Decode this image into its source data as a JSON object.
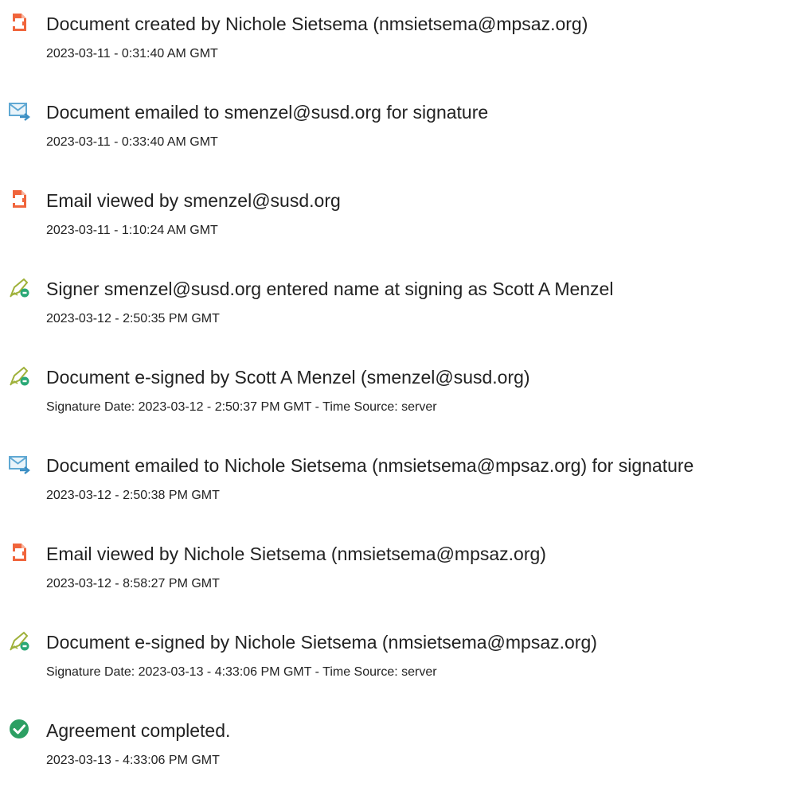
{
  "colors": {
    "document_icon": "#f0653c",
    "email_icon": "#5fa8d3",
    "sign_icon": "#9fb13a",
    "sign_badge": "#2aa876",
    "complete_icon": "#2c9f63",
    "text": "#222222"
  },
  "events": [
    {
      "icon": "document-icon",
      "title": "Document created by Nichole Sietsema (nmsietsema@mpsaz.org)",
      "detail": "2023-03-11 - 0:31:40 AM GMT"
    },
    {
      "icon": "email-icon",
      "title": "Document emailed to smenzel@susd.org for signature",
      "detail": "2023-03-11 - 0:33:40 AM GMT"
    },
    {
      "icon": "document-icon",
      "title": "Email viewed by smenzel@susd.org",
      "detail": "2023-03-11 - 1:10:24 AM GMT"
    },
    {
      "icon": "sign-icon",
      "title": "Signer smenzel@susd.org entered name at signing as Scott A Menzel",
      "detail": "2023-03-12 - 2:50:35 PM GMT"
    },
    {
      "icon": "sign-icon",
      "title": "Document e-signed by Scott A Menzel (smenzel@susd.org)",
      "detail": "Signature Date: 2023-03-12 - 2:50:37 PM GMT - Time Source: server"
    },
    {
      "icon": "email-icon",
      "title": "Document emailed to Nichole Sietsema (nmsietsema@mpsaz.org) for signature",
      "detail": "2023-03-12 - 2:50:38 PM GMT"
    },
    {
      "icon": "document-icon",
      "title": "Email viewed by Nichole Sietsema (nmsietsema@mpsaz.org)",
      "detail": "2023-03-12 - 8:58:27 PM GMT"
    },
    {
      "icon": "sign-icon",
      "title": "Document e-signed by Nichole Sietsema (nmsietsema@mpsaz.org)",
      "detail": "Signature Date: 2023-03-13 - 4:33:06 PM GMT - Time Source: server"
    },
    {
      "icon": "check-circle-icon",
      "title": "Agreement completed.",
      "detail": "2023-03-13 - 4:33:06 PM GMT"
    }
  ]
}
